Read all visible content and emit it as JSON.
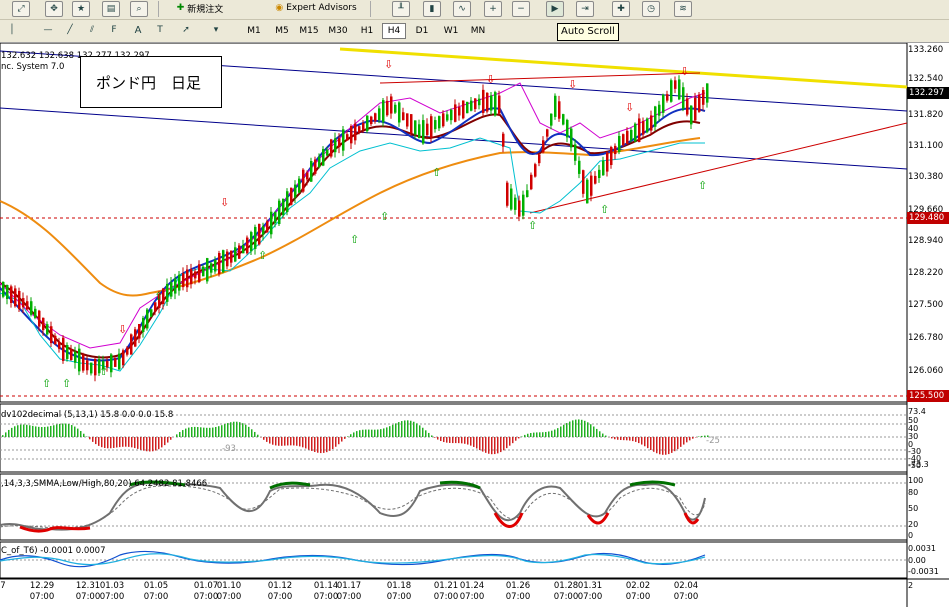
{
  "toolbar_top": {
    "new_order_label": "新規注文",
    "expert_advisors_label": "Expert Advisors",
    "icons": [
      "chart-zoom-icon",
      "crosshair-icon",
      "favorites-icon",
      "charts-icon",
      "search-icon",
      "new-order-icon",
      "expert-advisors-icon",
      "chart-prop-icon",
      "bar-chart-icon",
      "candles-icon",
      "line-chart-icon",
      "zoom-in-icon",
      "zoom-out-icon",
      "tile-icon",
      "auto-scroll-icon",
      "chart-shift-icon",
      "indicators-icon",
      "periods-icon",
      "templates-icon"
    ]
  },
  "toolbar_periods": {
    "items": [
      "M1",
      "M5",
      "M15",
      "M30",
      "H1",
      "H4",
      "D1",
      "W1",
      "MN"
    ],
    "active": "H4"
  },
  "tooltip": "Auto Scroll",
  "chart": {
    "header_prices": "132.632 132.638 132.277 132.297",
    "system_label": "nc. System 7.0",
    "title_box": "ポンド円　日足",
    "price_scale": [
      "133.260",
      "132.540",
      "131.820",
      "131.100",
      "130.380",
      "129.660",
      "128.940",
      "128.220",
      "127.500",
      "126.780",
      "126.060"
    ],
    "current_price": "132.297",
    "red_price_1": "129.480",
    "red_price_2": "125.500",
    "colors": {
      "yellow_line": "#f0e000",
      "blue_line": "#00008b",
      "red_trend": "#c00000",
      "orange_ma": "#ee8c10",
      "up_arrow": "#00a000",
      "down_arrow": "#e00000"
    }
  },
  "indicator1": {
    "label": "dv102decimal (5,13,1) 15.8 0.0 0.0 15.8",
    "scale": [
      "73.4",
      "50",
      "40",
      "30",
      "0",
      "-30",
      "-40",
      "-50",
      "-73.3"
    ],
    "left_inline": "-93",
    "right_inline": "-25"
  },
  "indicator2": {
    "label": ",14,3,3,SMMA,Low/High,80,20) 64.2482 81.8466",
    "scale": [
      "100",
      "80",
      "50",
      "20",
      "0"
    ]
  },
  "indicator3": {
    "label": "C_of_T6) -0.0001 0.0007",
    "scale": [
      "0.0031",
      "0.00",
      "-0.0031"
    ]
  },
  "time_axis": {
    "dates": [
      "7",
      "12.29",
      "12.31",
      "01.03",
      "01.05",
      "01.07",
      "01.10",
      "01.12",
      "01.14",
      "01.17",
      "01.18",
      "01.21",
      "01.24",
      "01.26",
      "01.28",
      "01.31",
      "02.02",
      "02.04"
    ],
    "times": [
      "07:00",
      "07:00",
      "07:00",
      "07:00",
      "07:00",
      "07:00",
      "07:00",
      "07:00",
      "07:00",
      "07:00",
      "07:00",
      "07:00",
      "07:00",
      "07:00",
      "07:00",
      "07:00",
      "07:00"
    ],
    "right_scale": "2"
  }
}
